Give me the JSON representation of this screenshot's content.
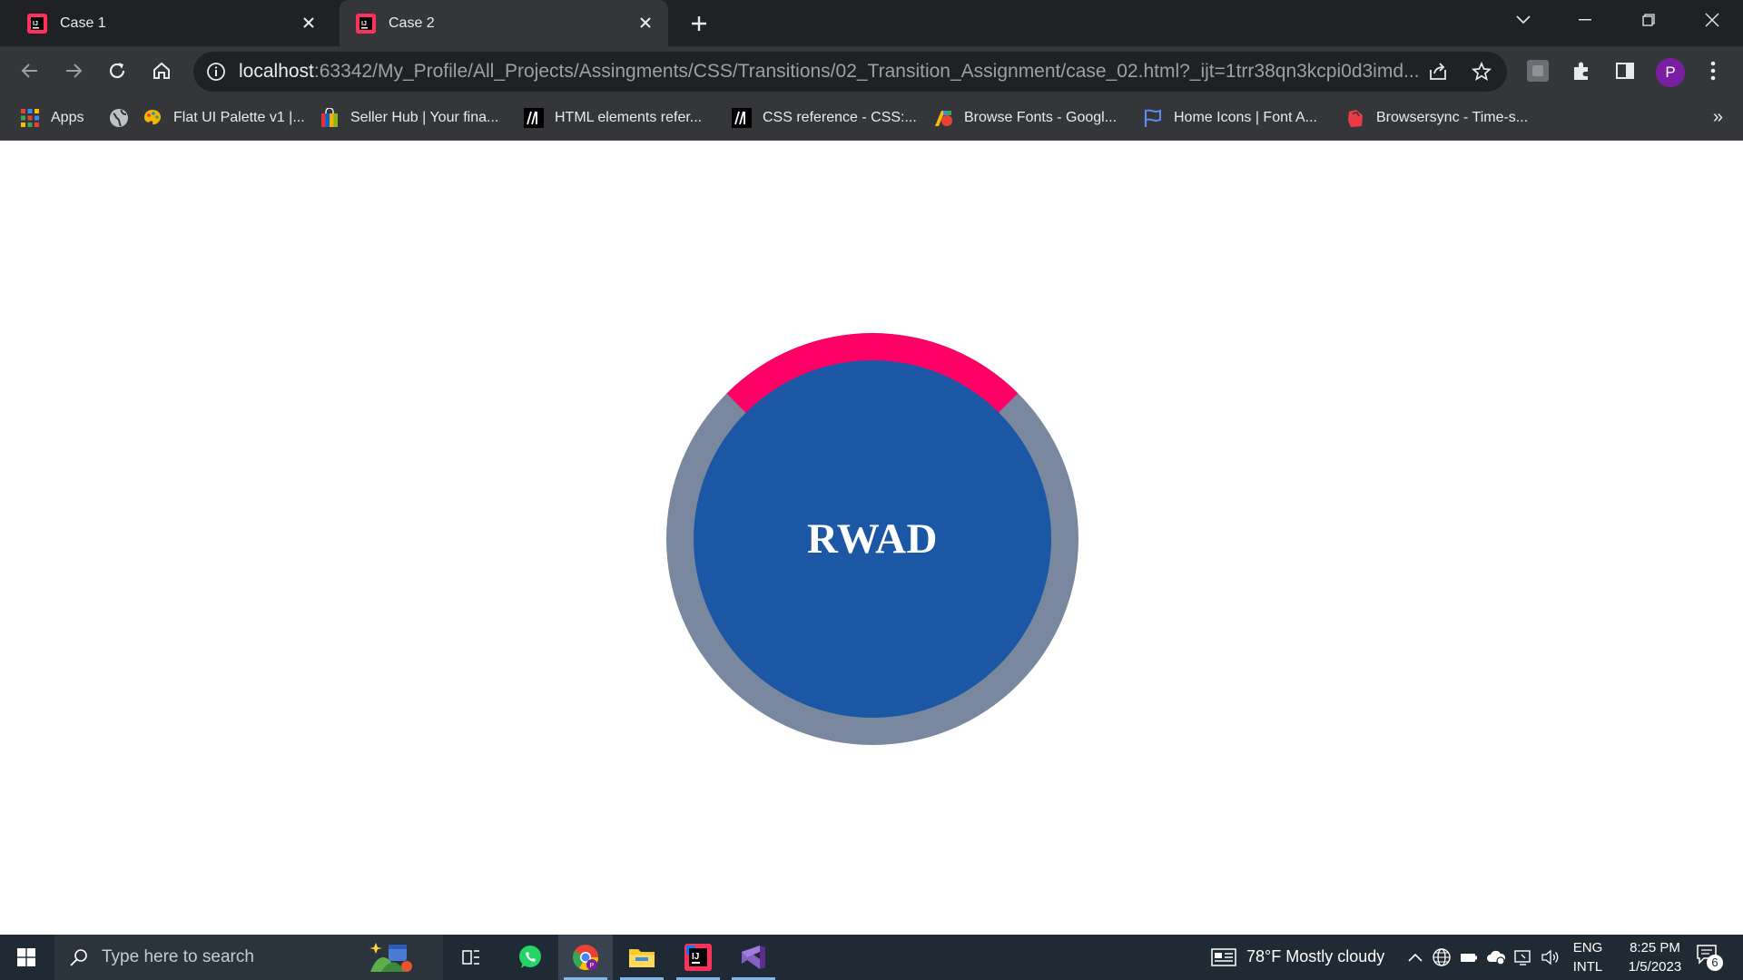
{
  "browser": {
    "tabs": [
      {
        "title": "Case 1",
        "active": false,
        "icon": "intellij-icon"
      },
      {
        "title": "Case 2",
        "active": true,
        "icon": "intellij-icon"
      }
    ],
    "address_bar": {
      "host": "localhost",
      "path": ":63342/My_Profile/All_Projects/Assingments/CSS/Transitions/02_Transition_Assignment/case_02.html?_ijt=1trr38qn3kcpi0d3imd..."
    },
    "profile_initial": "P",
    "bookmarks": [
      {
        "label": "Apps",
        "icon": "apps-grid-icon"
      },
      {
        "label": "",
        "icon": "globe-icon"
      },
      {
        "label": "Flat UI Palette v1 |...",
        "icon": "palette-icon"
      },
      {
        "label": "Seller Hub | Your fina...",
        "icon": "shopping-bag-icon"
      },
      {
        "label": "HTML elements refer...",
        "icon": "mdn-icon"
      },
      {
        "label": "CSS reference - CSS:...",
        "icon": "mdn-icon"
      },
      {
        "label": "Browse Fonts - Googl...",
        "icon": "google-fonts-icon"
      },
      {
        "label": "Home Icons | Font A...",
        "icon": "flag-icon"
      },
      {
        "label": "Browsersync - Time-s...",
        "icon": "browsersync-icon"
      }
    ],
    "bookmarks_overflow": "»"
  },
  "page": {
    "circle_text": "RWAD",
    "colors": {
      "ring": "#7a889f",
      "highlight_arc": "#ff0066",
      "disc": "#1c57a5",
      "text": "#ffffff"
    }
  },
  "taskbar": {
    "search_placeholder": "Type here to search",
    "weather": "78°F  Mostly cloudy",
    "language_top": "ENG",
    "language_bottom": "INTL",
    "time": "8:25 PM",
    "date": "1/5/2023",
    "notification_count": "6",
    "pinned": [
      "task-view-icon",
      "whatsapp-icon",
      "chrome-icon",
      "file-explorer-icon",
      "intellij-icon",
      "visual-studio-icon"
    ]
  }
}
